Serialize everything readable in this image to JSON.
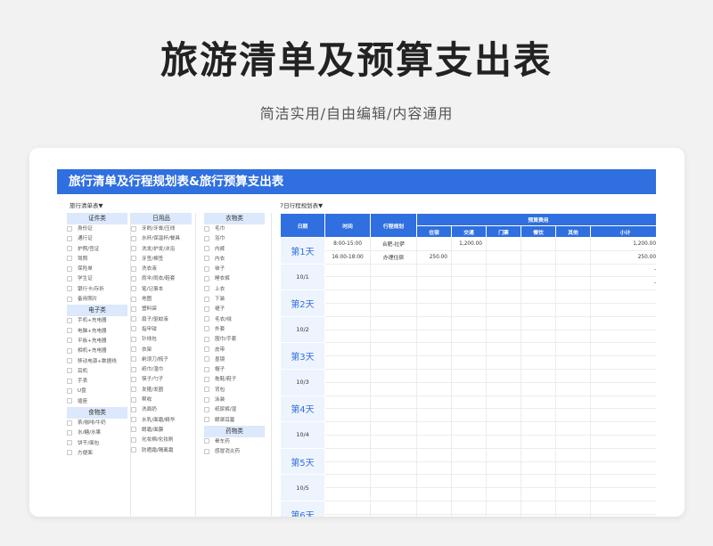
{
  "page": {
    "title": "旅游清单及预算支出表",
    "subtitle": "简洁实用/自由编辑/内容通用"
  },
  "sheet": {
    "banner": "旅行清单及行程规划表&旅行预算支出表",
    "checklist_caption": "旅行清单表▼",
    "itinerary_caption": "7日行程规划表▼"
  },
  "checklist": [
    {
      "groups": [
        {
          "title": "证件类",
          "items": [
            "身份证",
            "通行证",
            "护照/签证",
            "驾照",
            "保险单",
            "学生证",
            "银行卡/存折",
            "备用照片"
          ]
        },
        {
          "title": "电子类",
          "items": [
            "手机+充电器",
            "电脑+充电器",
            "平板+充电器",
            "相机+充电器",
            "移动电源+数据线",
            "耳机",
            "手表",
            "U盘",
            "插座"
          ]
        },
        {
          "title": "食物类",
          "items": [
            "茶/咖啡/牛奶",
            "水/糖/水果",
            "饼干/面包",
            "方便面"
          ]
        }
      ]
    },
    {
      "groups": [
        {
          "title": "日用品",
          "items": [
            "牙刷/牙膏/压线",
            "水杯/保温杯/餐具",
            "洗发/护发/沐浴",
            "牙签/棉签",
            "洗衣液",
            "雨伞/雨衣/鞋套",
            "笔/记事本",
            "地图",
            "塑料袋",
            "扇子/驱蚊液",
            "指甲钳",
            "针线包",
            "衣架",
            "剃须刀/梳子",
            "纸巾/湿巾",
            "筷子/勺子",
            "发箍/发圈",
            "帮收",
            "洗面奶",
            "水乳/面霜/精华",
            "眼霜/面膜",
            "化妆棉/化妆刷",
            "防晒霜/隔离霜"
          ]
        }
      ]
    },
    {
      "groups": [
        {
          "title": "衣物类",
          "items": [
            "毛巾",
            "浴巾",
            "内裤",
            "内衣",
            "袜子",
            "睡衣裤",
            "上衣",
            "下装",
            "裙子",
            "毛衣/绒",
            "外套",
            "围巾/手套",
            "皮带",
            "墨镜",
            "帽子",
            "拖鞋/鞋子",
            "背包",
            "泳装",
            "纸尿裤/湿",
            "眼罩耳塞"
          ]
        },
        {
          "title": "药物类",
          "items": [
            "晕车药",
            "感冒消炎药"
          ]
        }
      ]
    }
  ],
  "itinerary": {
    "headers": {
      "date": "日期",
      "time": "时间",
      "plan": "行程规划",
      "budget": "预算费用"
    },
    "budget_headers": [
      "住宿",
      "交通",
      "门票",
      "餐饮",
      "其他",
      "小计"
    ],
    "days": [
      {
        "label": "第1天",
        "date": "10/1",
        "rows": [
          {
            "time": "8:00-15:00",
            "plan": "合肥-拉萨",
            "values": [
              "",
              "1,200.00",
              "",
              "",
              "",
              "1,200.00"
            ]
          },
          {
            "time": "16:00-18:00",
            "plan": "办理住宿",
            "values": [
              "250.00",
              "",
              "",
              "",
              "",
              "250.00"
            ]
          },
          {
            "time": "",
            "plan": "",
            "values": [
              "",
              "",
              "",
              "",
              "",
              "-"
            ]
          },
          {
            "time": "",
            "plan": "",
            "values": [
              "",
              "",
              "",
              "",
              "",
              "-"
            ]
          }
        ]
      },
      {
        "label": "第2天",
        "date": "10/2"
      },
      {
        "label": "第3天",
        "date": "10/3"
      },
      {
        "label": "第4天",
        "date": "10/4"
      },
      {
        "label": "第5天",
        "date": "10/5"
      },
      {
        "label": "第6天",
        "date": ""
      }
    ]
  }
}
